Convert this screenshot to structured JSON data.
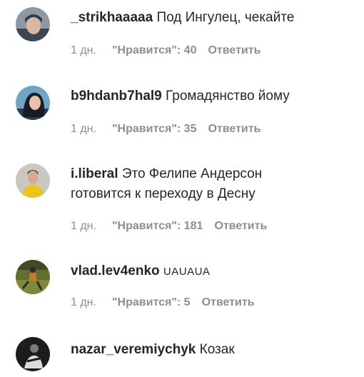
{
  "comments": [
    {
      "username": "_strikhaaaaa",
      "text": "Под Ингулец, чекайте",
      "time": "1 дн.",
      "likes": "\"Нравится\": 40",
      "reply": "Ответить",
      "avatar_colors": [
        "#7a8896",
        "#3c4654",
        "#d9b7a2"
      ]
    },
    {
      "username": "b9hdanb7hal9",
      "text": "Громадянство йому",
      "time": "1 дн.",
      "likes": "\"Нравится\": 35",
      "reply": "Ответить",
      "avatar_colors": [
        "#6fa6c8",
        "#1b1b22",
        "#e6c3ae"
      ]
    },
    {
      "username": "i.liberal",
      "text_line1": "Это Фелипе Андерсон",
      "text_line2": "готовится к переходу в Десну",
      "time": "1 дн.",
      "likes": "\"Нравится\": 181",
      "reply": "Ответить",
      "avatar_colors": [
        "#c9c7bf",
        "#e9c51e",
        "#3a3026"
      ]
    },
    {
      "username": "vlad.lev4enko",
      "text": "UAUAUA",
      "time": "1 дн.",
      "likes": "\"Нравится\": 5",
      "reply": "Ответить",
      "avatar_colors": [
        "#7d8a3c",
        "#c07a2a",
        "#2d2a22"
      ]
    },
    {
      "username": "nazar_veremiychyk",
      "text": "Козак",
      "avatar_colors": [
        "#1c1c1c",
        "#7a7a7a",
        "#dcdcdc"
      ]
    }
  ]
}
